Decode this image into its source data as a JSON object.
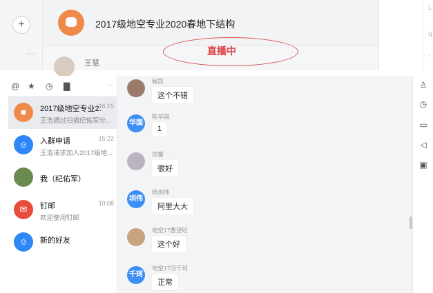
{
  "top_window": {
    "group_title": "2017级地空专业2020春地下结构",
    "member_name": "王慧",
    "live_label": "直播中",
    "dots": "···",
    "right_chars": [
      "L",
      "q",
      "、"
    ]
  },
  "sidebar": {
    "tools": [
      {
        "icon": "at-icon",
        "glyph": "@"
      },
      {
        "icon": "star-icon",
        "glyph": "★"
      },
      {
        "icon": "history-icon",
        "glyph": "◷"
      },
      {
        "icon": "document-icon",
        "glyph": "▇"
      },
      {
        "icon": "more-icon",
        "glyph": "···"
      }
    ],
    "sessions": [
      {
        "name": "2017级地空专业2...",
        "subtitle": "王浩通过扫描纪佑军分...",
        "time": "16:15",
        "avatar_color": "#f08a4b",
        "avatar_glyph": "■",
        "active": true
      },
      {
        "name": "入群申请",
        "subtitle": "王浩请求加入2017级地...",
        "time": "15:22",
        "avatar_color": "#2f86f6",
        "avatar_glyph": "☺",
        "active": false
      },
      {
        "name": "我（纪佑军）",
        "subtitle": "",
        "time": "",
        "avatar_color": "#6b8a52",
        "avatar_glyph": "",
        "active": false
      },
      {
        "name": "钉邮",
        "subtitle": "欢迎使用钉邮",
        "time": "10:08",
        "avatar_color": "#e84c3d",
        "avatar_glyph": "✉",
        "active": false
      },
      {
        "name": "新的好友",
        "subtitle": "",
        "time": "",
        "avatar_color": "#2f86f6",
        "avatar_glyph": "☺",
        "active": false
      }
    ]
  },
  "chat": {
    "messages": [
      {
        "sender": "程凯",
        "text": "这个不错",
        "avatar_text": "",
        "avatar_color": "#9a7b6a"
      },
      {
        "sender": "陈华国",
        "text": "1",
        "avatar_text": "华国",
        "avatar_color": "#3d8ff5"
      },
      {
        "sender": "周馨",
        "text": "很好",
        "avatar_text": "",
        "avatar_color": "#b9b4c0"
      },
      {
        "sender": "杨圳伟",
        "text": "阿里大大",
        "avatar_text": "圳伟",
        "avatar_color": "#3d8ff5"
      },
      {
        "sender": "地空17曹望旺",
        "text": "这个好",
        "avatar_text": "",
        "avatar_color": "#c9a37e"
      },
      {
        "sender": "地空17冯千珂",
        "text": "正常",
        "avatar_text": "千珂",
        "avatar_color": "#3d8ff5"
      }
    ]
  },
  "rail": {
    "icons": [
      {
        "name": "add-member-icon",
        "glyph": "♙"
      },
      {
        "name": "clock-icon",
        "glyph": "◷"
      },
      {
        "name": "folder-icon",
        "glyph": "▭"
      },
      {
        "name": "megaphone-icon",
        "glyph": "◁"
      },
      {
        "name": "tv-icon",
        "glyph": "▣"
      }
    ]
  }
}
